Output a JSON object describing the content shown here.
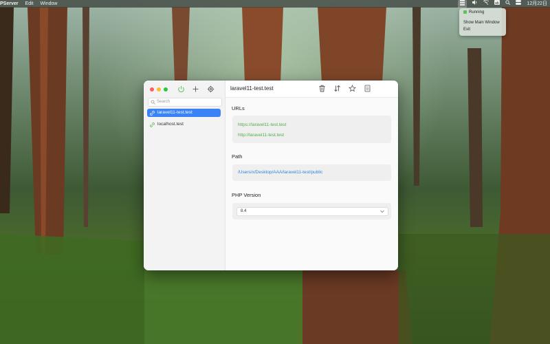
{
  "menubar": {
    "app_name": "PServer",
    "items": [
      "Edit",
      "Window"
    ],
    "clock": "12月22日"
  },
  "tray_menu": {
    "status": "Running",
    "show_main": "Show Main Window",
    "exit": "Exit"
  },
  "search": {
    "placeholder": "Search"
  },
  "sites": [
    {
      "label": "laravel11-test.test"
    },
    {
      "label": "localhost.test"
    }
  ],
  "main": {
    "title": "laravel11-test.test",
    "urls_label": "URLs",
    "urls": [
      "https://laravel11-test.test",
      "http://laravel11-test.test"
    ],
    "path_label": "Path",
    "path": "/Users/x/Desktop/AAA/laravel11-test/public",
    "php_label": "PHP Version",
    "php_value": "8.4"
  },
  "colors": {
    "accent": "#3a82f7",
    "url_green": "#4bb04b",
    "path_blue": "#2f86d6",
    "power_green": "#5cc25c"
  }
}
